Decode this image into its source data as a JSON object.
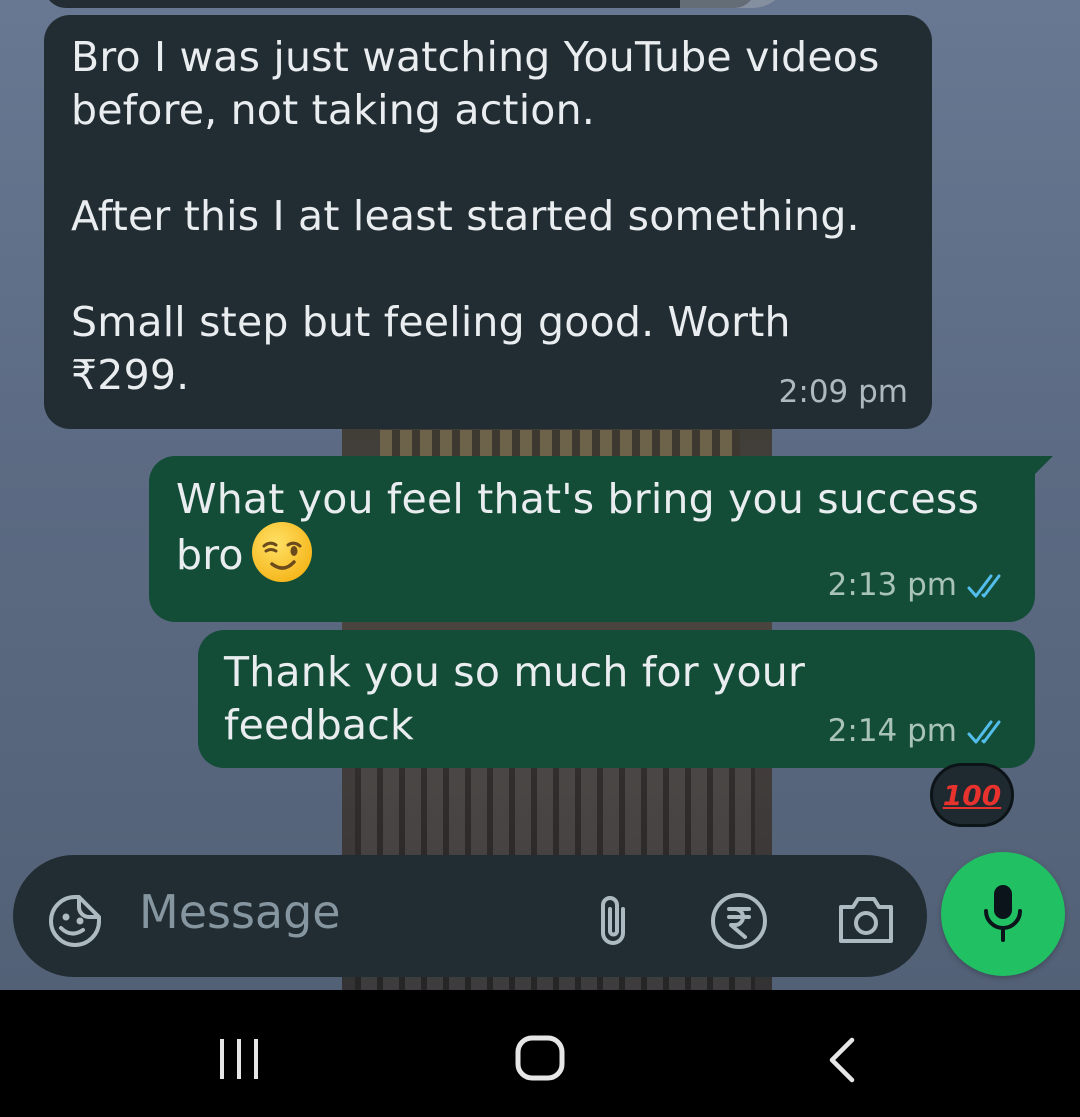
{
  "messages": [
    {
      "direction": "incoming",
      "text": "Bro I was just watching YouTube videos\nbefore, not taking action.\n\nAfter this I at least started something.\n\nSmall step but feeling good. Worth\n₹299.",
      "time": "2:09 pm"
    },
    {
      "direction": "outgoing",
      "text": "What you feel that's bring you success\nbro",
      "emoji": "winking-smile-emoji",
      "time": "2:13 pm",
      "status": "read"
    },
    {
      "direction": "outgoing",
      "text": "Thank you so much for your feedback",
      "time": "2:14 pm",
      "status": "read",
      "reaction": "100"
    }
  ],
  "composer": {
    "placeholder": "Message",
    "icons": [
      "emoji-sticker-icon",
      "paperclip-icon",
      "rupee-payment-icon",
      "camera-icon",
      "microphone-icon"
    ]
  },
  "navbar": {
    "icons": [
      "recents-icon",
      "home-icon",
      "back-icon"
    ]
  },
  "colors": {
    "incoming_bubble": "#222d33",
    "outgoing_bubble": "#134d37",
    "read_ticks": "#53bdeb",
    "mic_button": "#21c063",
    "reaction_red": "#e8322e"
  }
}
